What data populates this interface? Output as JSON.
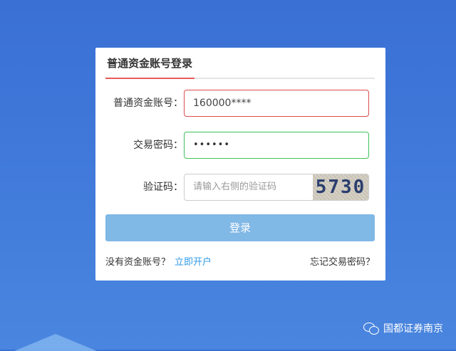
{
  "tab": {
    "label": "普通资金账号登录"
  },
  "form": {
    "account": {
      "label": "普通资金账号：",
      "value": "160000****"
    },
    "password": {
      "label": "交易密码：",
      "value": "••••••"
    },
    "captcha": {
      "label": "验证码：",
      "placeholder": "请输入右侧的验证码",
      "image_text": "5730"
    }
  },
  "login_button": "登录",
  "footer": {
    "no_account_text": "没有资金账号？",
    "open_account_link": "立即开户",
    "forgot_password_link": "忘记交易密码？"
  },
  "watermark": {
    "text": "国都证券南京",
    "icon": "wechat-icon"
  },
  "colors": {
    "background": "#3f78d8",
    "button": "#80b8e6",
    "link": "#2f9ae6",
    "tab_underline": "#e65a5a",
    "error_border": "#dd4b4b",
    "ok_border": "#3fc25c"
  }
}
